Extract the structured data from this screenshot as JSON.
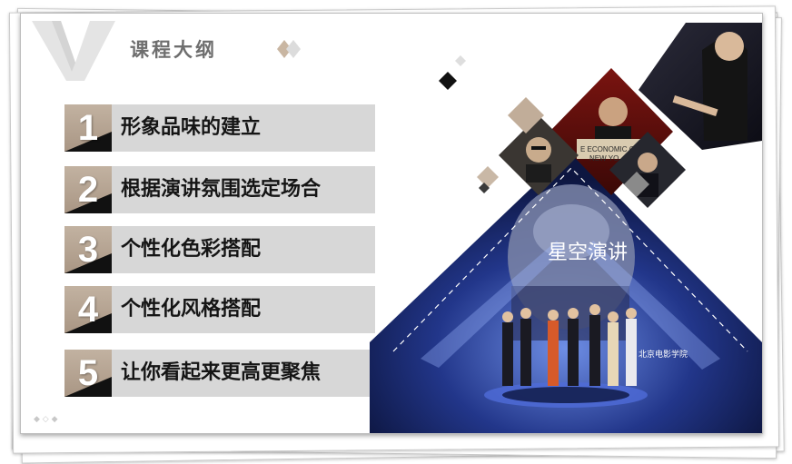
{
  "slide": {
    "title": "课程大纲"
  },
  "agenda": [
    {
      "number": "1",
      "text": "形象品味的建立"
    },
    {
      "number": "2",
      "text": "根据演讲氛围选定场合"
    },
    {
      "number": "3",
      "text": "个性化色彩搭配"
    },
    {
      "number": "4",
      "text": "个性化风格搭配"
    },
    {
      "number": "5",
      "text": "让你看起来更高更聚焦"
    }
  ],
  "photos": {
    "banner_text": "E ECONOMIC CLUB",
    "banner_text_2": "NEW YO",
    "stage_title": "星空演讲",
    "stage_sign": "北京电影学院"
  },
  "colors": {
    "accent_tan": "#b7a593",
    "item_bg": "#d7d7d7",
    "dark": "#111111",
    "title_gray": "#6e6e6e",
    "stage_blue": "#1a2a6e"
  },
  "icons": {
    "logo": "v-letter-logo",
    "title_decoration": "double-diamond-icon"
  }
}
